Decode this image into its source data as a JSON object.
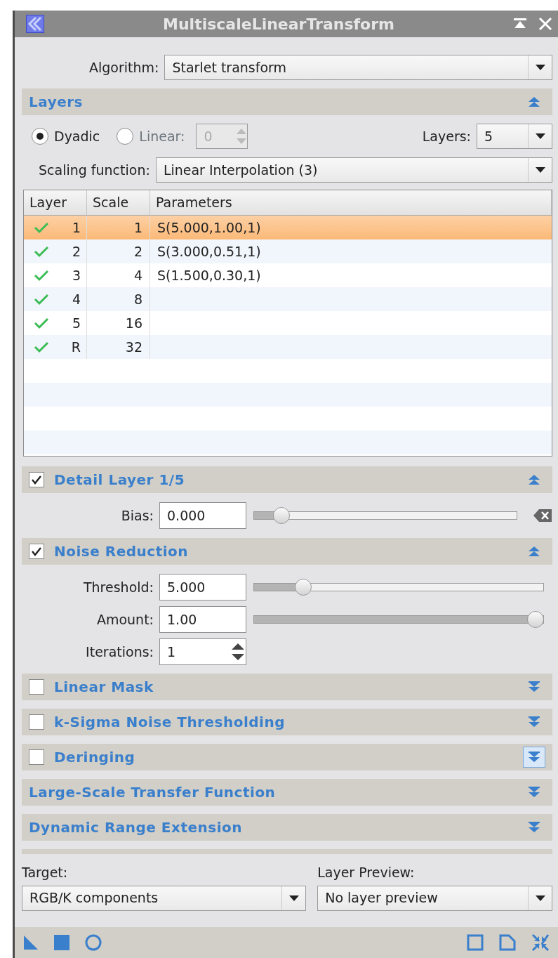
{
  "window": {
    "title": "MultiscaleLinearTransform"
  },
  "algorithm": {
    "label": "Algorithm:",
    "value": "Starlet transform"
  },
  "layers_section": {
    "title": "Layers",
    "expanded": true,
    "options": [
      {
        "label": "Dyadic",
        "selected": true
      },
      {
        "label": "Linear:",
        "selected": false,
        "value": "0",
        "disabled": true
      }
    ],
    "layers": {
      "label": "Layers:",
      "value": "5"
    },
    "scaling": {
      "label": "Scaling function:",
      "value": "Linear Interpolation (3)"
    },
    "table": {
      "columns": [
        "Layer",
        "Scale",
        "Parameters"
      ],
      "rows": [
        {
          "enabled": true,
          "layer": "1",
          "scale": "1",
          "parameters": "S(5.000,1.00,1)",
          "selected": true
        },
        {
          "enabled": true,
          "layer": "2",
          "scale": "2",
          "parameters": "S(3.000,0.51,1)",
          "selected": false
        },
        {
          "enabled": true,
          "layer": "3",
          "scale": "4",
          "parameters": "S(1.500,0.30,1)",
          "selected": false
        },
        {
          "enabled": true,
          "layer": "4",
          "scale": "8",
          "selected": false
        },
        {
          "enabled": true,
          "layer": "5",
          "scale": "16",
          "selected": false
        },
        {
          "enabled": true,
          "layer": "R",
          "scale": "32",
          "selected": false
        }
      ]
    }
  },
  "detail_section": {
    "title": "Detail Layer 1/5",
    "checked": true,
    "expanded": true,
    "bias": {
      "label": "Bias:",
      "value": "0.000",
      "level": 0.08
    }
  },
  "noise_section": {
    "title": "Noise Reduction",
    "checked": true,
    "expanded": true,
    "fields": [
      {
        "kind": "slider",
        "label": "Threshold:",
        "value": "5.000",
        "level": 0.15
      },
      {
        "kind": "slider",
        "label": "Amount:",
        "value": "1.00",
        "level": 1
      },
      {
        "kind": "spin",
        "label": "Iterations:",
        "value": "1"
      }
    ]
  },
  "collapsed_sections": [
    {
      "title": "Linear Mask",
      "checked": false,
      "expanded": false,
      "hovered": false
    },
    {
      "title": "k-Sigma Noise Thresholding",
      "checked": false,
      "expanded": false,
      "hovered": false
    },
    {
      "title": "Deringing",
      "checked": false,
      "expanded": false,
      "hovered": true
    },
    {
      "title": "Large-Scale Transfer Function",
      "expanded": false,
      "hovered": false
    },
    {
      "title": "Dynamic Range Extension",
      "expanded": false,
      "hovered": false
    }
  ],
  "target": {
    "label": "Target:",
    "value": "RGB/K components"
  },
  "layer_preview": {
    "label": "Layer Preview:",
    "value": "No layer preview"
  }
}
